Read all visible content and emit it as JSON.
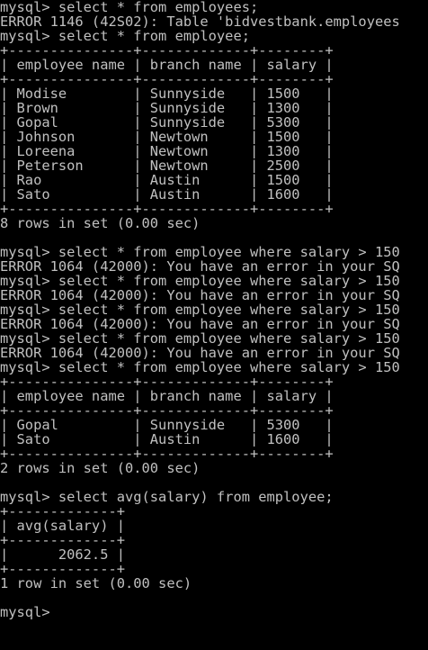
{
  "terminal": {
    "colors": {
      "background": "#000000",
      "text": "#c0c0c0"
    },
    "prompt": "mysql> ",
    "lines": [
      "mysql> select * from employees;",
      "ERROR 1146 (42S02): Table 'bidvestbank.employees",
      "mysql> select * from employee;",
      "+---------------+-------------+--------+",
      "| employee_name | branch_name | salary |",
      "+---------------+-------------+--------+",
      "| Modise        | Sunnyside   | 1500   |",
      "| Brown         | Sunnyside   | 1300   |",
      "| Gopal         | Sunnyside   | 5300   |",
      "| Johnson       | Newtown     | 1500   |",
      "| Loreena       | Newtown     | 1300   |",
      "| Peterson      | Newtown     | 2500   |",
      "| Rao           | Austin      | 1500   |",
      "| Sato          | Austin      | 1600   |",
      "+---------------+-------------+--------+",
      "8 rows in set (0.00 sec)",
      "",
      "mysql> select * from employee where salary > 150",
      "ERROR 1064 (42000): You have an error in your SQ",
      "mysql> select * from employee where salary > 150",
      "ERROR 1064 (42000): You have an error in your SQ",
      "mysql> select * from employee where salary > 150",
      "ERROR 1064 (42000): You have an error in your SQ",
      "mysql> select * from employee where salary > 150",
      "ERROR 1064 (42000): You have an error in your SQ",
      "mysql> select * from employee where salary > 150",
      "+---------------+-------------+--------+",
      "| employee_name | branch_name | salary |",
      "+---------------+-------------+--------+",
      "| Gopal         | Sunnyside   | 5300   |",
      "| Sato          | Austin      | 1600   |",
      "+---------------+-------------+--------+",
      "2 rows in set (0.00 sec)",
      "",
      "mysql> select avg(salary) from employee;",
      "+-------------+",
      "| avg(salary) |",
      "+-------------+",
      "|      2062.5 |",
      "+-------------+",
      "1 row in set (0.00 sec)",
      "",
      "mysql> "
    ]
  }
}
